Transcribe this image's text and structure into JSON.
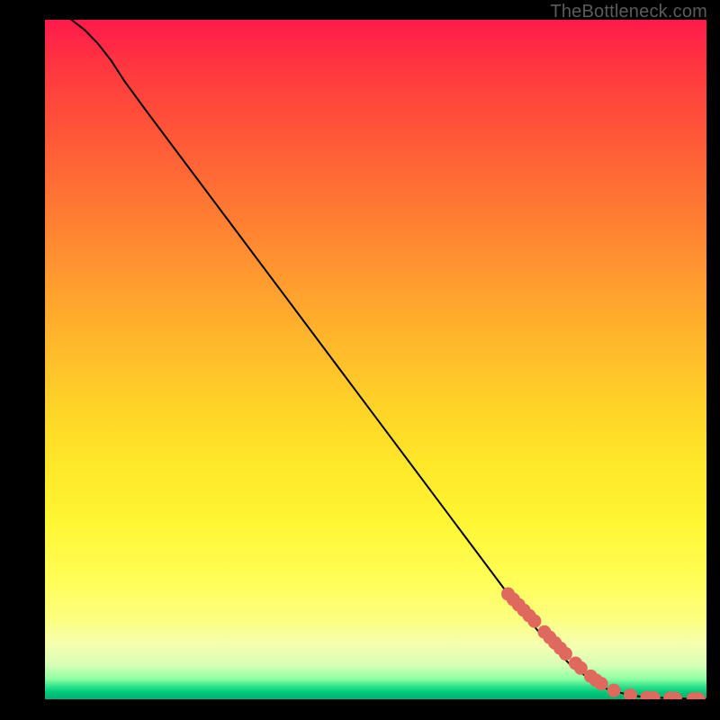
{
  "watermark": "TheBottleneck.com",
  "chart_data": {
    "type": "line",
    "title": "",
    "xlabel": "",
    "ylabel": "",
    "xlim": [
      0,
      100
    ],
    "ylim": [
      0,
      100
    ],
    "grid": false,
    "series": [
      {
        "name": "curve",
        "style": "solid-black",
        "x": [
          4,
          6,
          8,
          10,
          12,
          15,
          20,
          25,
          30,
          35,
          40,
          45,
          50,
          55,
          60,
          65,
          70,
          75,
          80,
          85,
          88,
          90,
          92,
          94,
          96,
          98,
          100
        ],
        "y": [
          100,
          98.5,
          96.5,
          94,
          91,
          87,
          80.5,
          74,
          67.5,
          61,
          54.5,
          48,
          41.5,
          35,
          28.5,
          22,
          15.5,
          9.5,
          4.5,
          1.5,
          0.7,
          0.4,
          0.25,
          0.18,
          0.12,
          0.08,
          0.05
        ]
      },
      {
        "name": "highlighted-points",
        "style": "salmon-dots",
        "x": [
          70.0,
          70.8,
          71.6,
          72.4,
          73.2,
          74.0,
          75.5,
          76.3,
          77.1,
          77.9,
          78.7,
          80.2,
          81.0,
          82.5,
          83.3,
          84.1,
          86.0,
          88.5,
          91.0,
          92.0,
          94.5,
          95.3,
          98.0,
          98.8
        ],
        "y": [
          15.5,
          14.7,
          13.9,
          13.1,
          12.3,
          11.5,
          9.9,
          9.1,
          8.3,
          7.5,
          6.7,
          5.3,
          4.6,
          3.4,
          2.8,
          2.3,
          1.3,
          0.6,
          0.25,
          0.22,
          0.15,
          0.13,
          0.07,
          0.06
        ]
      }
    ]
  },
  "colors": {
    "curve": "#000000",
    "dots": "#e0695e",
    "background_black": "#000000"
  }
}
